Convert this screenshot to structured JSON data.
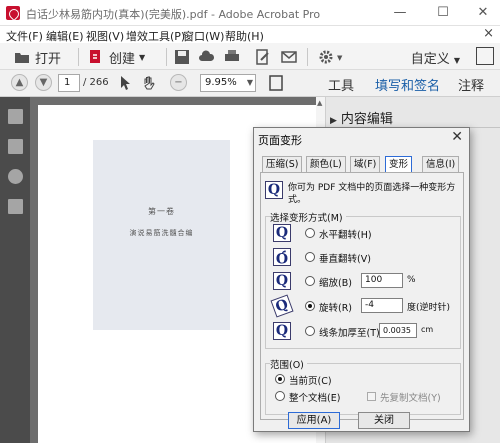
{
  "window": {
    "title": "白话少林易筋内功(真本)(完美版).pdf - Adobe Acrobat Pro",
    "controls": {
      "minimize": "—",
      "maximize": "☐",
      "close": "✕"
    }
  },
  "menubar": {
    "items": [
      "文件(F)",
      "编辑(E)",
      "视图(V)",
      "增效工具(P)",
      "窗口(W)",
      "帮助(H)"
    ],
    "close_doc": "×"
  },
  "toolbar1": {
    "open_label": "打开",
    "create_label": "创建",
    "customize_label": "自定义"
  },
  "toolbar2": {
    "page_current": "1",
    "page_total": "/ 266",
    "zoom": "9.95%",
    "tabs": [
      "工具",
      "填写和签名",
      "注释"
    ]
  },
  "right_pane": {
    "header": "内容编辑"
  },
  "document": {
    "scan_title": "第一卷",
    "scan_subtitle": "演说易筋洗髓合编"
  },
  "dialog": {
    "title": "页面变形",
    "close": "✕",
    "tabs": [
      "压缩(S)",
      "颜色(L)",
      "域(F)",
      "变形",
      "信息(I)"
    ],
    "active_tab": "变形",
    "description": "你可为 PDF 文档中的页面选择一种变形方式。",
    "transform_group_label": "选择变形方式(M)",
    "options": [
      {
        "label": "水平翻转(H)",
        "checked": false
      },
      {
        "label": "垂直翻转(V)",
        "checked": false
      },
      {
        "label": "缩放(B)",
        "checked": false,
        "value": "100",
        "unit": "%"
      },
      {
        "label": "旋转(R)",
        "checked": true,
        "value": "-4",
        "unit": "度(逆时针)"
      },
      {
        "label": "线条加厚至(T)",
        "checked": false,
        "value": "0.0035",
        "unit": "cm"
      }
    ],
    "range_group_label": "范围(O)",
    "range_options": [
      {
        "label": "当前页(C)",
        "checked": true
      },
      {
        "label": "整个文档(E)",
        "checked": false
      }
    ],
    "first_copy_label": "先复制文档(Y)",
    "apply_label": "应用(A)",
    "close_label": "关闭"
  }
}
